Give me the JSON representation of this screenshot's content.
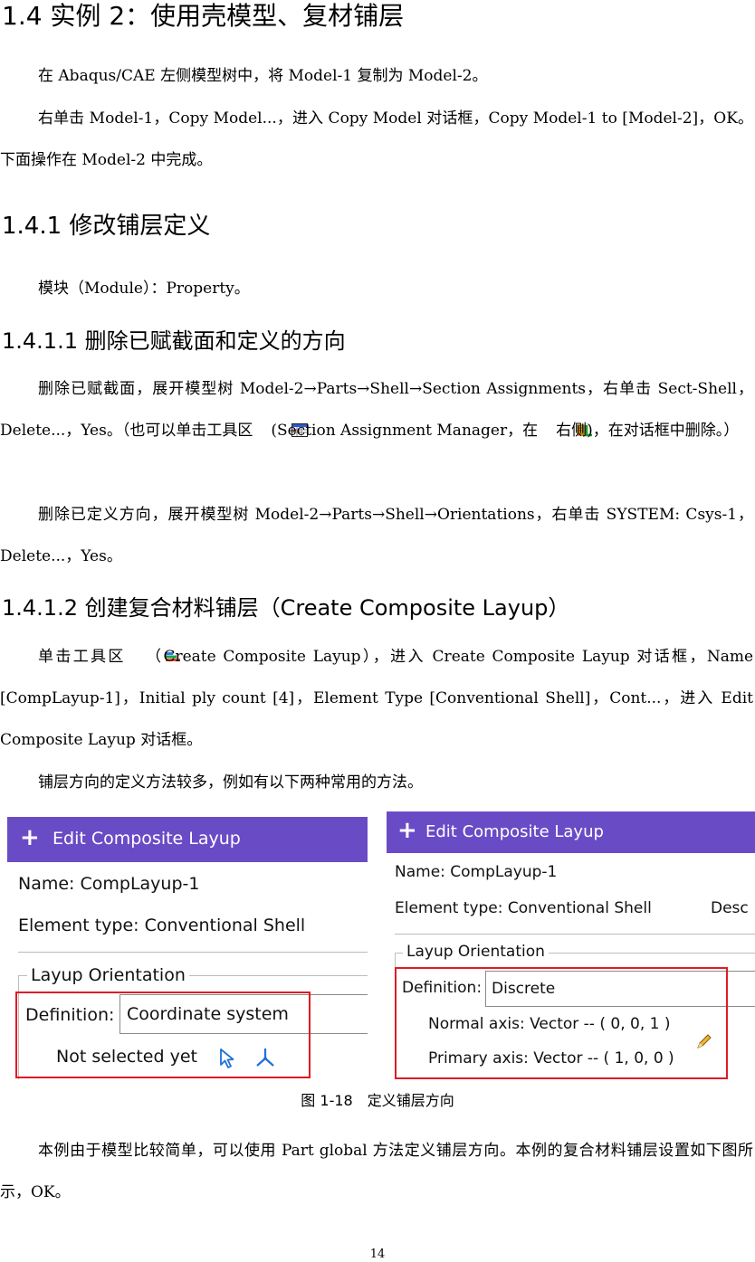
{
  "headings": {
    "h1": "1.4 实例 2：使用壳模型、复材铺层",
    "h2": "1.4.1 修改铺层定义",
    "h3a": "1.4.1.1 删除已赋截面和定义的方向",
    "h3b": "1.4.1.2 创建复合材料铺层（Create Composite Layup）"
  },
  "paragraphs": {
    "p1": "在 Abaqus/CAE 左侧模型树中，将 Model-1 复制为 Model-2。",
    "p2": "右单击 Model-1，Copy Model...，进入 Copy Model 对话框，Copy Model-1 to [Model-2]，OK。下面操作在 Model-2 中完成。",
    "p3": "模块（Module）：Property。",
    "p4_a": "删除已赋截面，展开模型树 Model-2→Parts→Shell→Section Assignments，右单击 Sect-Shell，Delete...，Yes。（也可以单击工具区",
    "p4_b": "(Section Assignment Manager，在",
    "p4_c": "右侧)，在对话框中删除。）",
    "p5": "删除已定义方向，展开模型树 Model-2→Parts→Shell→Orientations，右单击 SYSTEM: Csys-1，Delete...，Yes。",
    "p6_a": "单击工具区",
    "p6_b": "（Create Composite Layup），进入 Create Composite Layup 对话框，Name [CompLayup-1]，Initial ply count [4]，Element Type [Conventional Shell]，Cont...，进入 Edit Composite Layup 对话框。",
    "p7": "铺层方向的定义方法较多，例如有以下两种常用的方法。",
    "p8": "本例由于模型比较简单，可以使用 Part global 方法定义铺层方向。本例的复合材料铺层设置如下图所示，OK。"
  },
  "figure": {
    "caption": "图 1-18　定义铺层方向",
    "left_dialog": {
      "title": "Edit Composite Layup",
      "name_line": "Name:  CompLayup-1",
      "element_line": "Element type:  Conventional Shell",
      "group_title": "Layup Orientation",
      "definition_label": "Definition:",
      "definition_value": "Coordinate system",
      "status": "Not selected yet"
    },
    "right_dialog": {
      "title": "Edit Composite Layup",
      "name_line": "Name:  CompLayup-1",
      "element_line": "Element type:  Conventional Shell",
      "desc_cut": "Desc",
      "group_title": "Layup Orientation",
      "definition_label": "Definition:",
      "definition_value": "Discrete",
      "normal_axis": "Normal axis: Vector -- ( 0, 0, 1 )",
      "primary_axis": "Primary axis: Vector -- ( 1, 0, 0 )"
    }
  },
  "page_number": "14",
  "icons": [
    "section-assignment-manager-icon",
    "assign-section-icon",
    "create-composite-layup-icon",
    "select-arrow-icon",
    "csys-axes-icon",
    "pencil-edit-icon"
  ],
  "colors": {
    "titlebar": "#6a4bc6",
    "highlight": "#e01b24"
  }
}
